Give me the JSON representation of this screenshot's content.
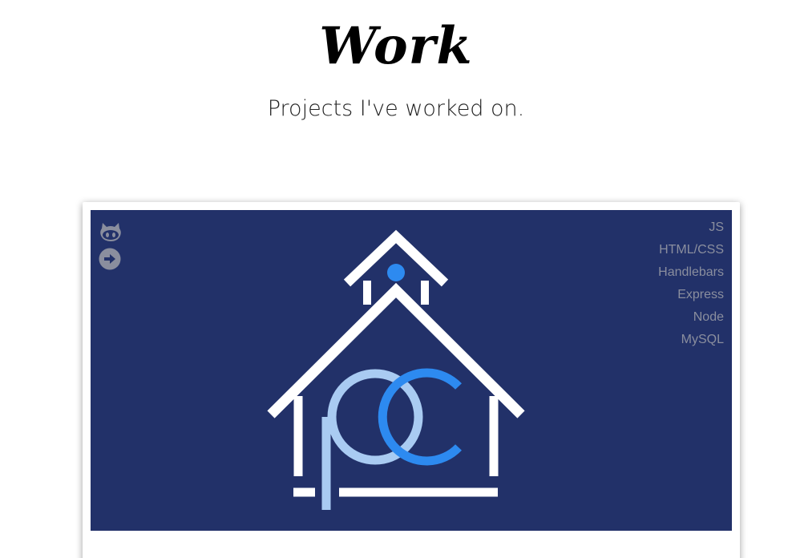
{
  "section": {
    "title": "Work",
    "subtitle": "Projects I've worked on."
  },
  "project": {
    "links": [
      {
        "icon": "github-icon"
      },
      {
        "icon": "arrow-circle-right-icon"
      }
    ],
    "technologies": [
      "JS",
      "HTML/CSS",
      "Handlebars",
      "Express",
      "Node",
      "MySQL"
    ],
    "colors": {
      "background": "#223169",
      "logo_outline": "#ffffff",
      "logo_p": "#a9cbf2",
      "logo_c": "#2d8af0",
      "icon": "#8a8e9e"
    }
  }
}
